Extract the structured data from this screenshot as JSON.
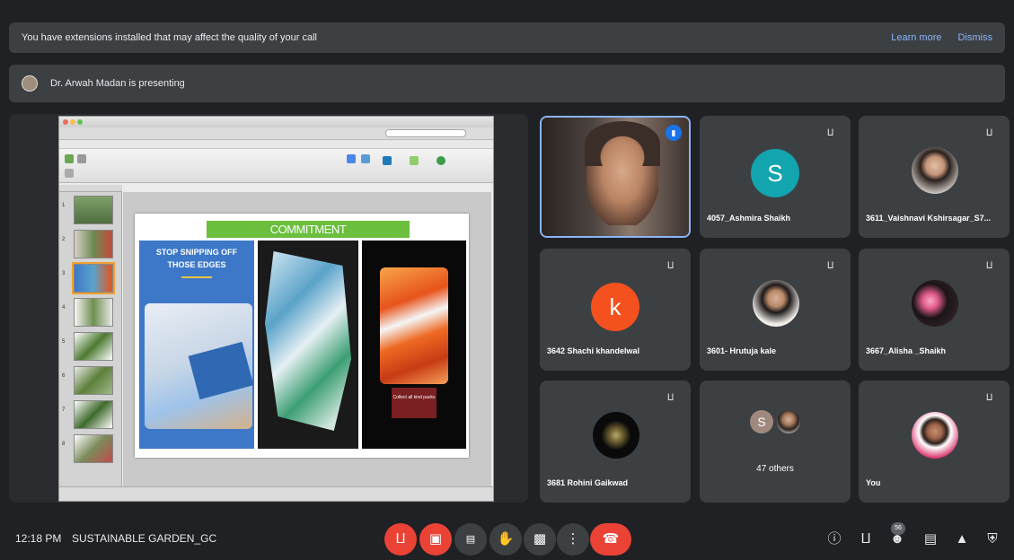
{
  "extension_bar": {
    "message": "You have extensions installed that may affect the quality of your call",
    "learn_more": "Learn more",
    "dismiss": "Dismiss"
  },
  "presenting_bar": {
    "text": "Dr. Arwah Madan is presenting"
  },
  "slide": {
    "title": "COMMITMENT",
    "left_caption_line1": "STOP SNIPPING OFF",
    "left_caption_line2": "THOSE EDGES",
    "right_caption": "Collect all kind packs"
  },
  "participants": [
    {
      "name": "",
      "type": "video",
      "speaking": true
    },
    {
      "name": "4057_Ashmira Shaikh",
      "type": "letter",
      "letter": "S",
      "color": "#12a4af",
      "muted": true
    },
    {
      "name": "3611_Vaishnavi Kshirsagar_S7...",
      "type": "photo",
      "muted": true
    },
    {
      "name": "3642 Shachi khandelwal",
      "type": "letter",
      "letter": "k",
      "color": "#f4511e",
      "muted": true
    },
    {
      "name": "3601- Hrutuja kale",
      "type": "photo",
      "muted": true
    },
    {
      "name": "3667_Alisha _Shaikh",
      "type": "photo",
      "muted": true
    },
    {
      "name": "3681 Rohini Gaikwad",
      "type": "photo",
      "muted": true
    },
    {
      "name": "47 others",
      "type": "group",
      "letter": "S",
      "color": "#a1887f"
    },
    {
      "name": "You",
      "type": "photo",
      "muted": true
    }
  ],
  "bottom_bar": {
    "time": "12:18 PM",
    "meeting_name": "SUSTAINABLE GARDEN_GC",
    "people_count": "56"
  },
  "colors": {
    "background": "#202124",
    "surface": "#3c4043",
    "accent_blue": "#8ab4f8",
    "danger_red": "#ea4335"
  },
  "icons": [
    "mic-off-icon",
    "camera-off-icon",
    "captions-icon",
    "raise-hand-icon",
    "present-icon",
    "more-options-icon",
    "leave-call-icon",
    "info-icon",
    "people-icon",
    "chat-icon",
    "activities-icon",
    "host-controls-icon"
  ]
}
